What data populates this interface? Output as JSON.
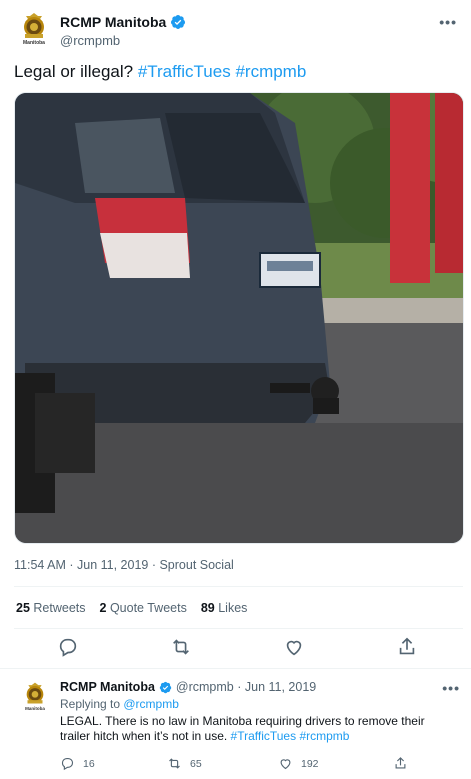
{
  "tweet": {
    "author_name": "RCMP Manitoba",
    "author_handle": "@rcmpmb",
    "avatar_caption": "Manitoba",
    "text_plain": "Legal or illegal? ",
    "hashtag_1": "#TrafficTues",
    "hashtag_2": "#rcmpmb",
    "timestamp": "11:54 AM · Jun 11, 2019 · Sprout Social",
    "stats": {
      "retweets_count": "25",
      "retweets_label": "Retweets",
      "quote_count": "2",
      "quote_label": "Quote Tweets",
      "likes_count": "89",
      "likes_label": "Likes"
    }
  },
  "reply": {
    "author_name": "RCMP Manitoba",
    "author_meta": "@rcmpmb · Jun 11, 2019",
    "avatar_caption": "Manitoba",
    "replying_prefix": "Replying to ",
    "replying_to": "@rcmpmb",
    "text_plain": "LEGAL. There is no law in Manitoba requiring drivers to remove their trailer hitch when it’s not in use. ",
    "hashtag_1": "#TrafficTues",
    "hashtag_2": "#rcmpmb",
    "reply_count": "16",
    "retweet_count": "65",
    "like_count": "192"
  },
  "colors": {
    "accent": "#1d9bf0",
    "text": "#0f1419",
    "secondary": "#536471"
  },
  "icons": [
    "rcmp-crest-icon",
    "verified-badge-icon",
    "more-icon",
    "reply-icon",
    "retweet-icon",
    "like-icon",
    "share-icon"
  ]
}
